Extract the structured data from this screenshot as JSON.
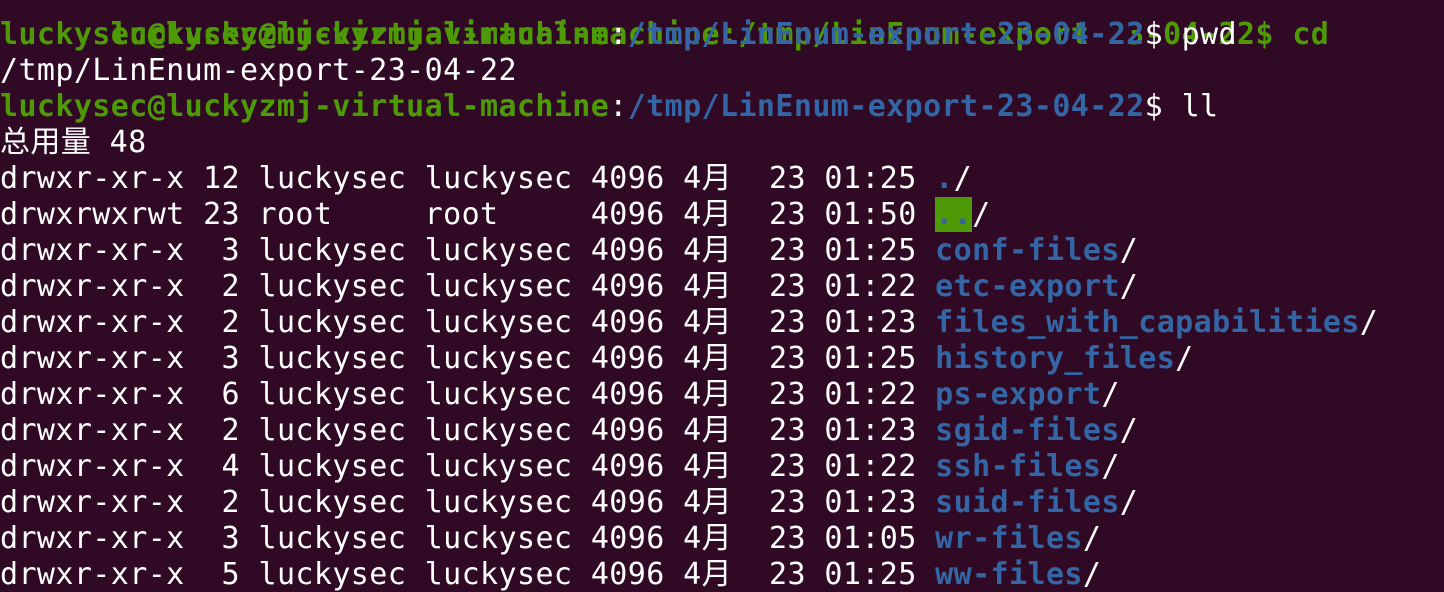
{
  "prompt": {
    "user_host": "luckysec@luckyzmj-virtual-machine",
    "colon": ":",
    "cwd": "/tmp/LinEnum-export-23-04-22",
    "symbol": "$ "
  },
  "top_partial_line": "luckysec@luckyzmj-virtual-machine:/tmp/LinEnum-export-23-04-22$ cd",
  "commands": [
    {
      "cmd": "pwd",
      "output": "/tmp/LinEnum-export-23-04-22"
    },
    {
      "cmd": "ll",
      "output": "总用量 48"
    }
  ],
  "listing": [
    {
      "perms": "drwxr-xr-x",
      "links": "12",
      "owner": "luckysec",
      "group": "luckysec",
      "size": "4096",
      "month": "4月",
      "day": "23",
      "time": "01:25",
      "name": ".",
      "suffix": "/",
      "highlight": false
    },
    {
      "perms": "drwxrwxrwt",
      "links": "23",
      "owner": "root    ",
      "group": "root    ",
      "size": "4096",
      "month": "4月",
      "day": "23",
      "time": "01:50",
      "name": "..",
      "suffix": "/",
      "highlight": true
    },
    {
      "perms": "drwxr-xr-x",
      "links": " 3",
      "owner": "luckysec",
      "group": "luckysec",
      "size": "4096",
      "month": "4月",
      "day": "23",
      "time": "01:25",
      "name": "conf-files",
      "suffix": "/",
      "highlight": false
    },
    {
      "perms": "drwxr-xr-x",
      "links": " 2",
      "owner": "luckysec",
      "group": "luckysec",
      "size": "4096",
      "month": "4月",
      "day": "23",
      "time": "01:22",
      "name": "etc-export",
      "suffix": "/",
      "highlight": false
    },
    {
      "perms": "drwxr-xr-x",
      "links": " 2",
      "owner": "luckysec",
      "group": "luckysec",
      "size": "4096",
      "month": "4月",
      "day": "23",
      "time": "01:23",
      "name": "files_with_capabilities",
      "suffix": "/",
      "highlight": false
    },
    {
      "perms": "drwxr-xr-x",
      "links": " 3",
      "owner": "luckysec",
      "group": "luckysec",
      "size": "4096",
      "month": "4月",
      "day": "23",
      "time": "01:25",
      "name": "history_files",
      "suffix": "/",
      "highlight": false
    },
    {
      "perms": "drwxr-xr-x",
      "links": " 6",
      "owner": "luckysec",
      "group": "luckysec",
      "size": "4096",
      "month": "4月",
      "day": "23",
      "time": "01:22",
      "name": "ps-export",
      "suffix": "/",
      "highlight": false
    },
    {
      "perms": "drwxr-xr-x",
      "links": " 2",
      "owner": "luckysec",
      "group": "luckysec",
      "size": "4096",
      "month": "4月",
      "day": "23",
      "time": "01:23",
      "name": "sgid-files",
      "suffix": "/",
      "highlight": false
    },
    {
      "perms": "drwxr-xr-x",
      "links": " 4",
      "owner": "luckysec",
      "group": "luckysec",
      "size": "4096",
      "month": "4月",
      "day": "23",
      "time": "01:22",
      "name": "ssh-files",
      "suffix": "/",
      "highlight": false
    },
    {
      "perms": "drwxr-xr-x",
      "links": " 2",
      "owner": "luckysec",
      "group": "luckysec",
      "size": "4096",
      "month": "4月",
      "day": "23",
      "time": "01:23",
      "name": "suid-files",
      "suffix": "/",
      "highlight": false
    },
    {
      "perms": "drwxr-xr-x",
      "links": " 3",
      "owner": "luckysec",
      "group": "luckysec",
      "size": "4096",
      "month": "4月",
      "day": "23",
      "time": "01:05",
      "name": "wr-files",
      "suffix": "/",
      "highlight": false
    },
    {
      "perms": "drwxr-xr-x",
      "links": " 5",
      "owner": "luckysec",
      "group": "luckysec",
      "size": "4096",
      "month": "4月",
      "day": "23",
      "time": "01:25",
      "name": "ww-files",
      "suffix": "/",
      "highlight": false
    }
  ],
  "colors": {
    "background": "#300a24",
    "prompt_user": "#4e9a06",
    "prompt_path": "#3465a4",
    "directory": "#3465a4",
    "sticky_bg": "#4e9a06",
    "text": "#ffffff"
  }
}
